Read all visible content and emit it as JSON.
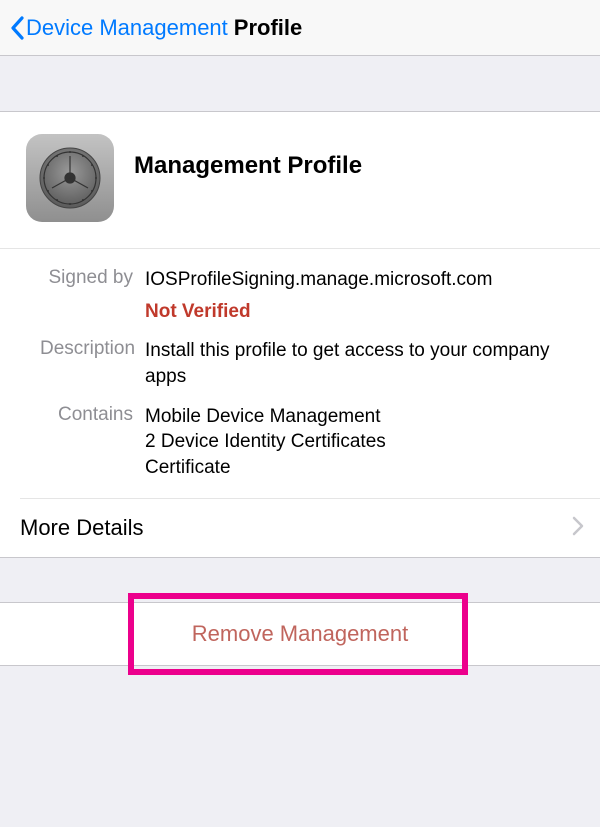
{
  "nav": {
    "back_label": "Device Management",
    "title": "Profile"
  },
  "profile": {
    "title": "Management Profile",
    "signed_by_label": "Signed by",
    "signed_by_value": "IOSProfileSigning.manage.microsoft.com",
    "verification_status": "Not Verified",
    "description_label": "Description",
    "description_value": "Install this profile to get access to your company apps",
    "contains_label": "Contains",
    "contains_line1": "Mobile Device Management",
    "contains_line2": "2 Device Identity Certificates",
    "contains_line3": "Certificate"
  },
  "more_details": {
    "label": "More Details"
  },
  "remove": {
    "label": "Remove Management"
  }
}
